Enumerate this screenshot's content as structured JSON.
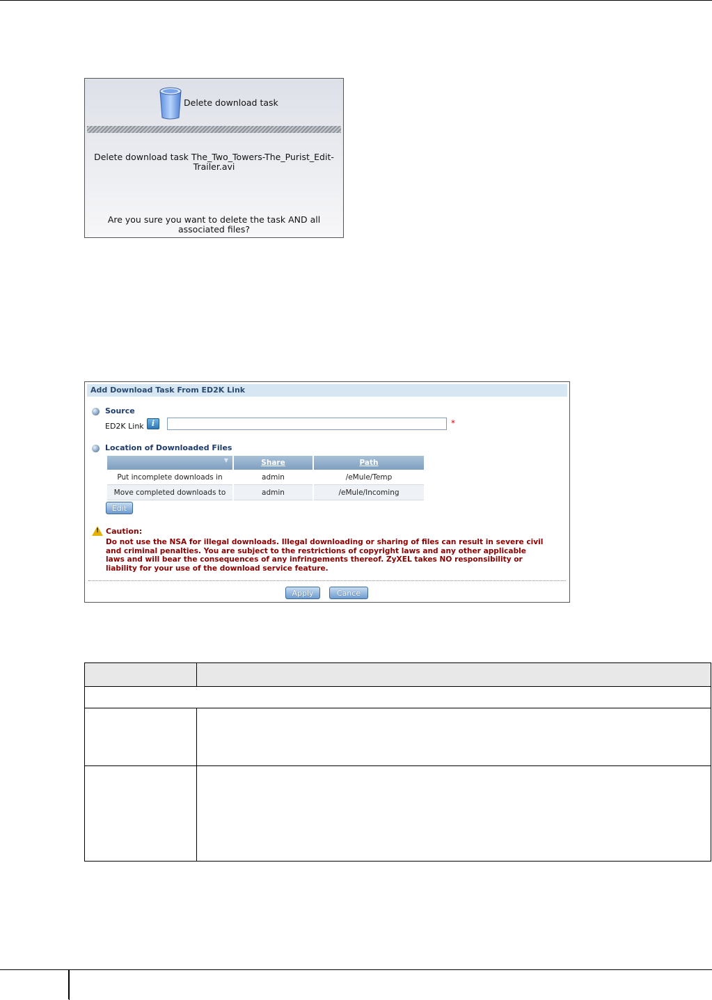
{
  "delete_dialog": {
    "title": "Delete download task",
    "message_line1": "Delete download task The_Two_Towers-The_Purist_Edit-",
    "message_line2": "Trailer.avi",
    "confirm_line1": "Are you sure you want to delete the task AND all",
    "confirm_line2": "associated files?",
    "icon": "trash-bin-icon"
  },
  "ed2k_panel": {
    "title": "Add Download Task From ED2K Link",
    "source_heading": "Source",
    "link_label": "ED2K Link",
    "link_value": "",
    "required_mark": "*",
    "location_heading": "Location of Downloaded Files",
    "table": {
      "columns": [
        "",
        "Share",
        "Path"
      ],
      "rows": [
        [
          "Put incomplete downloads in",
          "admin",
          "/eMule/Temp"
        ],
        [
          "Move completed downloads to",
          "admin",
          "/eMule/Incoming"
        ]
      ]
    },
    "edit_label": "Edit",
    "caution_title": "Caution:",
    "caution_lines": [
      "Do not use the NSA for illegal downloads. Illegal downloading or sharing of files can result in severe civil",
      "and criminal penalties. You are subject to the restrictions of copyright laws and any other applicable",
      "laws and will bear the consequences of any infringements thereof. ZyXEL takes NO responsibility or",
      "liability for your use of the download service feature."
    ],
    "apply_label": "Apply",
    "cancel_label": "Cance"
  },
  "colors": {
    "panel_header_bg": "#d6e6f2",
    "heading_text": "#1d3a6b",
    "caution_text": "#8b0000",
    "button_blue": "#6e9bcf"
  }
}
